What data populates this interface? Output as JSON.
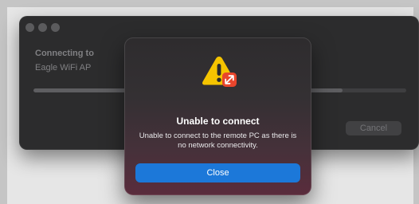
{
  "window": {
    "connecting_label": "Connecting to",
    "target_name": "Eagle WiFi AP",
    "cancel_label": "Cancel",
    "progress_fraction": 0.83
  },
  "dialog": {
    "title": "Unable to connect",
    "message": "Unable to connect to the remote PC as there is no network connectivity.",
    "close_label": "Close",
    "icon": "warning-icon",
    "badge_icon": "remote-desktop-icon"
  },
  "colors": {
    "accent": "#1c78d9",
    "warning": "#f5c400",
    "badge": "#e8452c"
  }
}
